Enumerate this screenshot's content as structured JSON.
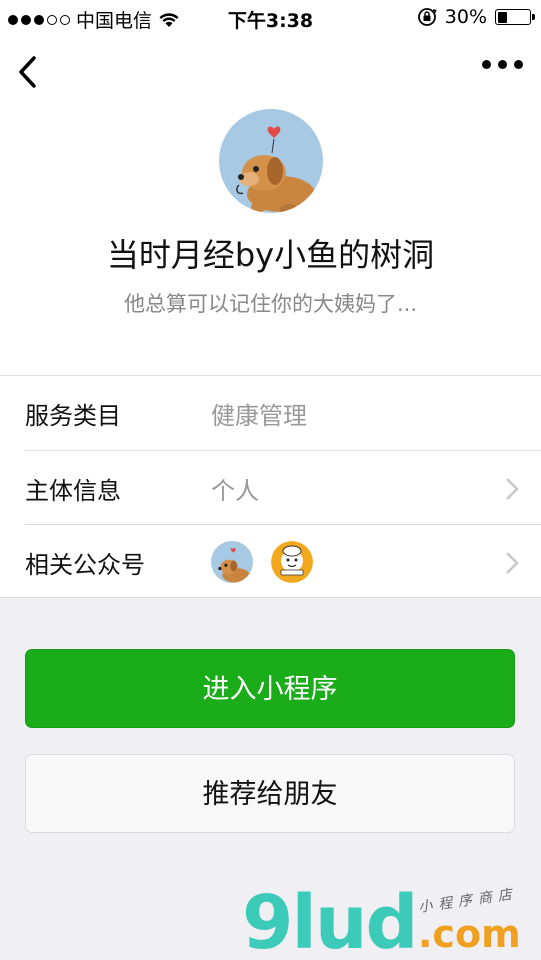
{
  "status_bar": {
    "carrier": "中国电信",
    "time": "下午3:38",
    "battery": "30%",
    "battery_level": 0.3,
    "signal_bars": 3
  },
  "nav": {
    "back_icon": "chevron-left-icon",
    "more_icon": "more-dots-icon"
  },
  "profile": {
    "title": "当时月经by小鱼的树洞",
    "subtitle": "他总算可以记住你的大姨妈了..."
  },
  "info_rows": [
    {
      "label": "服务类目",
      "value": "健康管理"
    },
    {
      "label": "主体信息",
      "value": "个人"
    },
    {
      "label": "相关公众号",
      "value": ""
    }
  ],
  "buttons": {
    "enter": "进入小程序",
    "share": "推荐给朋友"
  },
  "watermark": {
    "main": "9lud",
    "domain": ".com",
    "tagline": "小程序商店"
  },
  "colors": {
    "primary": "#1aad19",
    "background": "#efeff4",
    "watermark_teal": "#3ccbb8",
    "watermark_orange": "#f0a020"
  }
}
